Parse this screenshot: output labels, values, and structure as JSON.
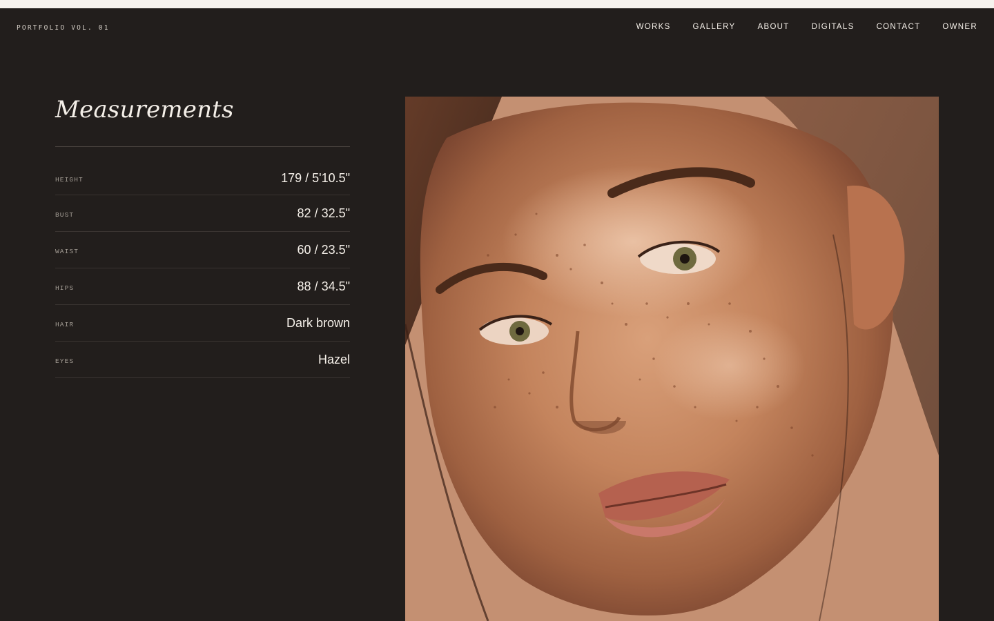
{
  "header": {
    "brand": "PORTFOLIO VOL. 01",
    "nav": [
      {
        "label": "WORKS"
      },
      {
        "label": "GALLERY"
      },
      {
        "label": "ABOUT"
      },
      {
        "label": "DIGITALS"
      },
      {
        "label": "CONTACT"
      },
      {
        "label": "OWNER"
      }
    ]
  },
  "measurements": {
    "title": "Measurements",
    "rows": [
      {
        "label": "HEIGHT",
        "value": "179 / 5'10.5\""
      },
      {
        "label": "BUST",
        "value": "82 / 32.5\""
      },
      {
        "label": "WAIST",
        "value": "60 / 23.5\""
      },
      {
        "label": "HIPS",
        "value": "88 / 34.5\""
      },
      {
        "label": "HAIR",
        "value": "Dark brown"
      },
      {
        "label": "EYES",
        "value": "Hazel"
      }
    ]
  },
  "photo": {
    "subject": "freckled-face-portrait"
  },
  "colors": {
    "background": "#221e1c",
    "top_strip": "#f6f3ee",
    "text_primary": "#f4efe8",
    "text_muted": "#a59e96",
    "divider": "#3a3431"
  }
}
